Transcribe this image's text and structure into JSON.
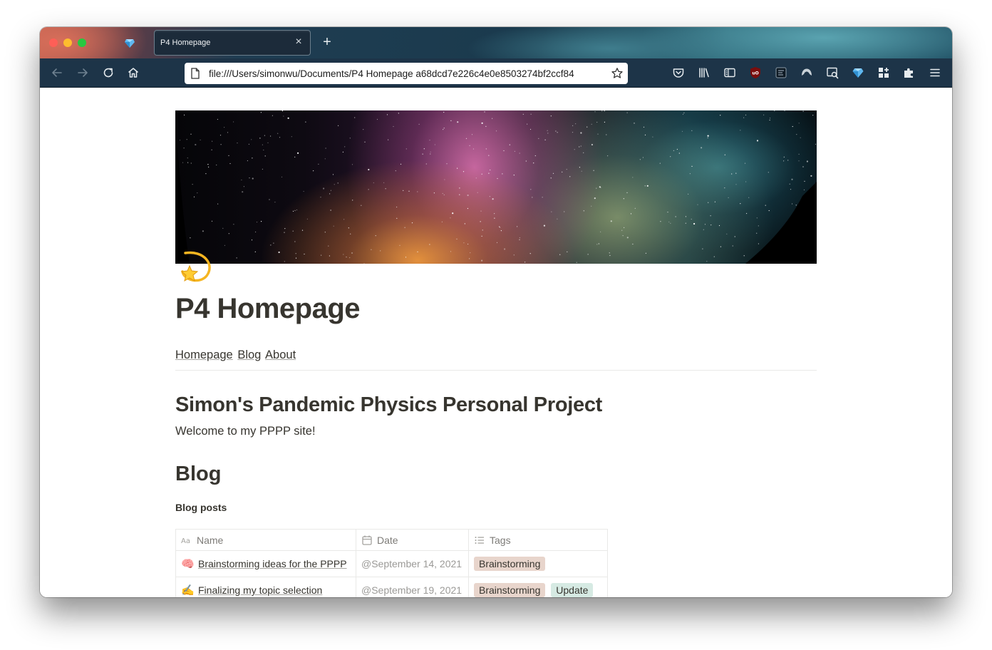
{
  "browser": {
    "tab_title": "P4 Homepage",
    "tab_close_glyph": "×",
    "new_tab_glyph": "+",
    "url": "file:///Users/simonwu/Documents/P4 Homepage a68dcd7e226c4e0e8503274bf2ccf84",
    "toolbar_icons": [
      "back-icon",
      "forward-icon",
      "reload-icon",
      "home-icon",
      "pocket-icon",
      "library-icon",
      "sidebar-icon",
      "ublock-icon",
      "reader-icon",
      "shield-icon",
      "search-extension-icon",
      "gem-icon",
      "grid-icon",
      "puzzle-icon",
      "menu-icon"
    ]
  },
  "page": {
    "icon_name": "dizzy-star-icon",
    "title": "P4 Homepage",
    "nav_links": [
      "Homepage",
      "Blog",
      "About"
    ],
    "heading": "Simon's Pandemic Physics Personal Project",
    "welcome": "Welcome to my PPPP site!",
    "blog_heading": "Blog",
    "database_title": "Blog posts",
    "columns": [
      "Name",
      "Date",
      "Tags"
    ],
    "column_icons": [
      "text-property-icon",
      "calendar-icon",
      "list-icon"
    ],
    "rows": [
      {
        "emoji": "🧠",
        "name": "Brainstorming ideas for the PPPP",
        "date": "@September 14, 2021",
        "tags": [
          "Brainstorming"
        ]
      },
      {
        "emoji": "✍",
        "name": "Finalizing my topic selection",
        "date": "@September 19, 2021",
        "tags": [
          "Brainstorming",
          "Update"
        ]
      }
    ],
    "tag_colors": {
      "Brainstorming": "#e8d5cc",
      "Update": "#d6eae3"
    }
  }
}
